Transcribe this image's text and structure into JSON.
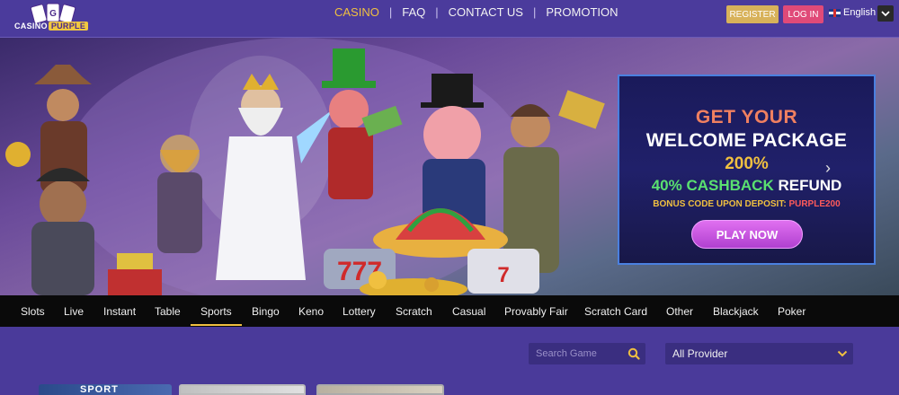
{
  "header": {
    "logo": {
      "brand_top": "CASINO",
      "brand_accent": "PURPLE"
    },
    "nav": [
      {
        "label": "CASINO",
        "active": true
      },
      {
        "label": "FAQ",
        "active": false
      },
      {
        "label": "CONTACT US",
        "active": false
      },
      {
        "label": "PROMOTION",
        "active": false
      }
    ],
    "register_label": "REGISTER",
    "login_label": "LOG IN",
    "language": "English"
  },
  "banner": {
    "promo": {
      "line1": "GET YOUR",
      "line2": "WELCOME PACKAGE",
      "percent": "200%",
      "cashback_green": "40% CASHBACK",
      "cashback_white": " REFUND",
      "code_prefix": "BONUS CODE UPON DEPOSIT: ",
      "code_value": "PURPLE200",
      "cta": "PLAY NOW"
    }
  },
  "categories": [
    {
      "label": "Slots",
      "active": false
    },
    {
      "label": "Live",
      "active": false
    },
    {
      "label": "Instant",
      "active": false
    },
    {
      "label": "Table",
      "active": false
    },
    {
      "label": "Sports",
      "active": true
    },
    {
      "label": "Bingo",
      "active": false
    },
    {
      "label": "Keno",
      "active": false
    },
    {
      "label": "Lottery",
      "active": false
    },
    {
      "label": "Scratch",
      "active": false
    },
    {
      "label": "Casual",
      "active": false
    },
    {
      "label": "Provably Fair",
      "active": false
    },
    {
      "label": "Scratch Card",
      "active": false
    },
    {
      "label": "Other",
      "active": false
    },
    {
      "label": "Blackjack",
      "active": false
    },
    {
      "label": "Poker",
      "active": false
    }
  ],
  "search": {
    "placeholder": "Search Game"
  },
  "provider": {
    "selected": "All Provider"
  },
  "thumbnails": [
    {
      "text": "SPORT"
    }
  ],
  "colors": {
    "page_bg": "#4a3a9a",
    "accent_gold": "#f0c040",
    "login_pink": "#e04a78",
    "register_gold": "#d8b25a"
  }
}
